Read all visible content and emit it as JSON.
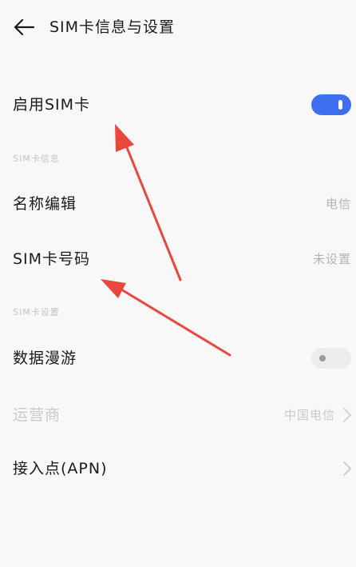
{
  "header": {
    "title": "SIM卡信息与设置"
  },
  "enable_sim": {
    "label": "启用SIM卡",
    "state": "on"
  },
  "section_info": {
    "label": "SIM卡信息"
  },
  "name_edit": {
    "label": "名称编辑",
    "value": "电信"
  },
  "sim_number": {
    "label": "SIM卡号码",
    "value": "未设置"
  },
  "section_settings": {
    "label": "SIM卡设置"
  },
  "data_roaming": {
    "label": "数据漫游",
    "state": "off"
  },
  "carrier": {
    "label": "运营商",
    "value": "中国电信"
  },
  "apn": {
    "label": "接入点(APN)"
  },
  "colors": {
    "accent": "#3d6ff0",
    "annotation_arrow": "#e8473d"
  }
}
